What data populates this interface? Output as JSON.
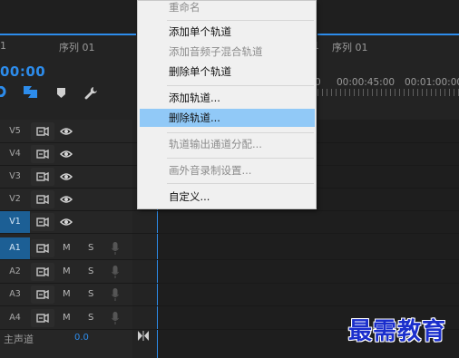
{
  "header": {
    "seq_left_num": "1",
    "seq_left": "序列 01",
    "seq_right": "序列 01",
    "seq_right_num": "1",
    "timecode": "00:00"
  },
  "ruler": {
    "label_1": "00:00:45:00",
    "label_2": "00:01:00:00",
    "label_0": "0"
  },
  "tracks": {
    "video": [
      {
        "label": "V5"
      },
      {
        "label": "V4"
      },
      {
        "label": "V3"
      },
      {
        "label": "V2"
      },
      {
        "label": "V1"
      }
    ],
    "audio": [
      {
        "label": "A1",
        "m": "M",
        "s": "S"
      },
      {
        "label": "A2",
        "m": "M",
        "s": "S"
      },
      {
        "label": "A3",
        "m": "M",
        "s": "S"
      },
      {
        "label": "A4",
        "m": "M",
        "s": "S"
      }
    ]
  },
  "master": {
    "label": "主声道",
    "value": "0.0"
  },
  "menu": {
    "items": [
      {
        "label": "重命名",
        "disabled": true
      },
      {
        "label": "添加单个轨道",
        "disabled": false
      },
      {
        "label": "添加音频子混合轨道",
        "disabled": true
      },
      {
        "label": "删除单个轨道",
        "disabled": false
      },
      {
        "label": "添加轨道...",
        "disabled": false
      },
      {
        "label": "删除轨道...",
        "disabled": false,
        "selected": true
      },
      {
        "label": "轨道输出通道分配...",
        "disabled": true
      },
      {
        "label": "画外音录制设置...",
        "disabled": true
      },
      {
        "label": "自定义...",
        "disabled": false
      }
    ]
  },
  "watermark": "最需教育",
  "colors": {
    "accent": "#2d8ceb",
    "menu_highlight": "#91c9f7",
    "track_on": "#1c5f95",
    "watermark": "#1a2ecc"
  }
}
